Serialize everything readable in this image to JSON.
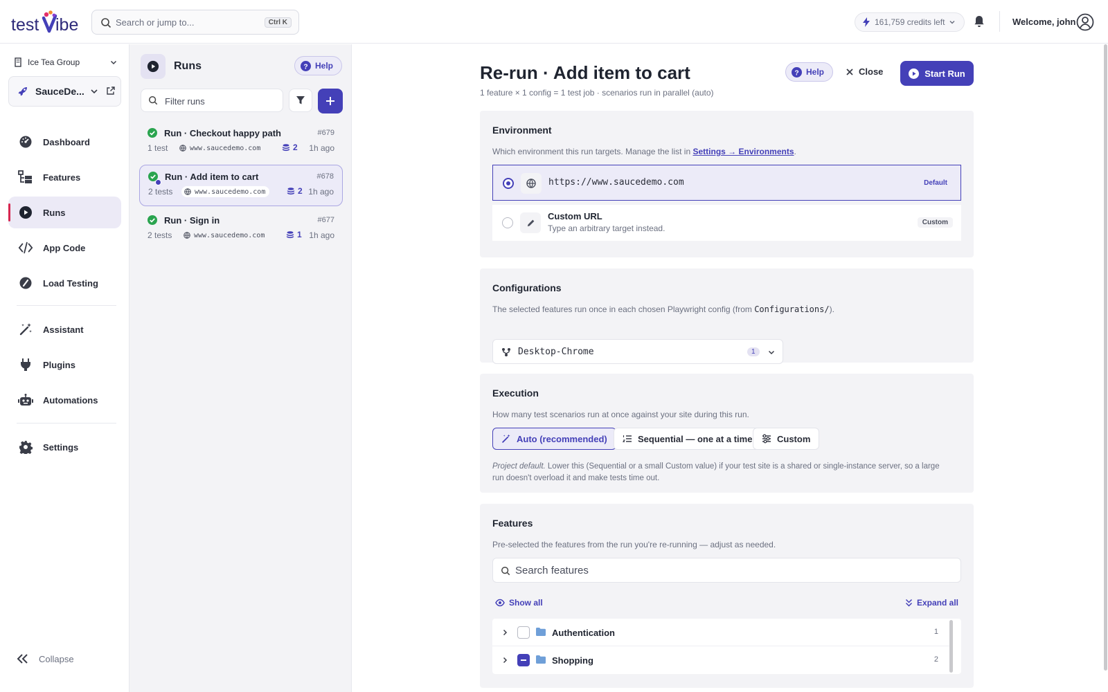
{
  "app": {
    "logo_text": "testVibe"
  },
  "topbar": {
    "search_placeholder": "Search or jump to...",
    "search_shortcut": "Ctrl K",
    "credits": "161,759 credits left",
    "welcome": "Welcome, john"
  },
  "sidebar": {
    "org": "Ice Tea Group",
    "project": "SauceDe...",
    "items": [
      {
        "label": "Dashboard",
        "icon": "dashboard-icon"
      },
      {
        "label": "Features",
        "icon": "features-icon"
      },
      {
        "label": "Runs",
        "icon": "runs-icon",
        "active": true
      },
      {
        "label": "App Code",
        "icon": "code-icon"
      },
      {
        "label": "Load Testing",
        "icon": "gauge-icon"
      },
      {
        "label": "Assistant",
        "icon": "magic-wand-icon"
      },
      {
        "label": "Plugins",
        "icon": "plug-icon"
      },
      {
        "label": "Automations",
        "icon": "robot-icon"
      },
      {
        "label": "Settings",
        "icon": "gear-icon"
      }
    ],
    "collapse_label": "Collapse"
  },
  "runs_panel": {
    "title": "Runs",
    "help_label": "Help",
    "filter_placeholder": "Filter runs",
    "runs": [
      {
        "name": "Run · Checkout happy path",
        "id": "#679",
        "tests": "1 test",
        "host": "www.saucedemo.com",
        "count": "2",
        "ago": "1h ago",
        "status": "passed"
      },
      {
        "name": "Run · Add item to cart",
        "id": "#678",
        "tests": "2 tests",
        "host": "www.saucedemo.com",
        "count": "2",
        "ago": "1h ago",
        "status": "passed",
        "selected": true
      },
      {
        "name": "Run · Sign in",
        "id": "#677",
        "tests": "2 tests",
        "host": "www.saucedemo.com",
        "count": "1",
        "ago": "1h ago",
        "status": "passed"
      }
    ]
  },
  "main": {
    "title": "Re-run · Add item to cart",
    "subtitle": "1 feature × 1 config = 1 test job · scenarios run in parallel (auto)",
    "help_label": "Help",
    "close_label": "Close",
    "start_label": "Start Run",
    "environment": {
      "title": "Environment",
      "desc_prefix": "Which environment this run targets. Manage the list in ",
      "desc_link": "Settings → Environments",
      "desc_suffix": ".",
      "options": [
        {
          "label": "https://www.saucedemo.com",
          "tag": "Default",
          "selected": true
        },
        {
          "label": "Custom URL",
          "sublabel": "Type an arbitrary target instead.",
          "tag": "Custom",
          "selected": false
        }
      ]
    },
    "configurations": {
      "title": "Configurations",
      "desc_prefix": "The selected features run once in each chosen Playwright config (from ",
      "desc_code": "Configurations/",
      "desc_suffix": ").",
      "selected": "Desktop-Chrome",
      "count": "1"
    },
    "execution": {
      "title": "Execution",
      "desc": "How many test scenarios run at once against your site during this run.",
      "modes": [
        "Auto (recommended)",
        "Sequential — one at a time",
        "Custom"
      ],
      "selected_mode": "Auto (recommended)",
      "note_em": "Project default.",
      "note": " Lower this (Sequential or a small Custom value) if your test site is a shared or single-instance server, so a large run doesn't overload it and make tests time out."
    },
    "features": {
      "title": "Features",
      "desc": "Pre-selected the features from the run you're re-running — adjust as needed.",
      "search_placeholder": "Search features",
      "show_all": "Show all",
      "expand_all": "Expand all",
      "tree": [
        {
          "name": "Authentication",
          "count": "1",
          "checked": "none"
        },
        {
          "name": "Shopping",
          "count": "2",
          "checked": "partial"
        }
      ]
    }
  },
  "colors": {
    "accent": "#4440b8",
    "success": "#2aa44f"
  }
}
